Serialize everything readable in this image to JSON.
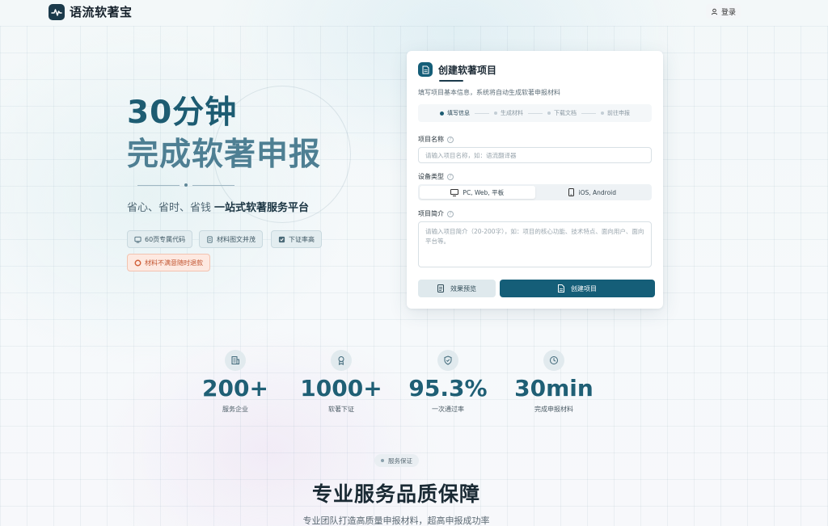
{
  "header": {
    "logo_text": "语流软著宝",
    "login_label": "登录"
  },
  "hero": {
    "title_line1": "30分钟",
    "title_line2": "完成软著申报",
    "subtitle_plain": "省心、省时、省钱",
    "subtitle_bold": "一站式软著服务平台",
    "features": [
      {
        "label": "60页专属代码",
        "icon": "code-icon"
      },
      {
        "label": "材料图文并茂",
        "icon": "document-icon"
      },
      {
        "label": "下证率高",
        "icon": "check-icon"
      }
    ],
    "guarantee": {
      "label": "材料不满意随时退款",
      "icon": "refund-icon"
    }
  },
  "form": {
    "title": "创建软著项目",
    "description": "填写项目基本信息，系统将自动生成软著申报材料",
    "steps": [
      "填写信息",
      "生成材料",
      "下载文档",
      "前往申报"
    ],
    "active_step": 0,
    "project_name": {
      "label": "项目名称",
      "placeholder": "请输入项目名称，如：语流翻译器",
      "value": ""
    },
    "device_type": {
      "label": "设备类型",
      "options": [
        "PC, Web, 平板",
        "iOS, Android"
      ],
      "selected": 0
    },
    "project_intro": {
      "label": "项目简介",
      "placeholder": "请输入项目简介（20-200字），如：项目的核心功能、技术特点、面向用户、面向平台等。",
      "value": ""
    },
    "preview_label": "效果预览",
    "create_label": "创建项目"
  },
  "stats": [
    {
      "value": "200+",
      "caption": "服务企业",
      "icon": "building-icon"
    },
    {
      "value": "1000+",
      "caption": "软著下证",
      "icon": "award-icon"
    },
    {
      "value": "95.3%",
      "caption": "一次通过率",
      "icon": "shield-check-icon"
    },
    {
      "value": "30min",
      "caption": "完成申报材料",
      "icon": "clock-icon"
    }
  ],
  "section": {
    "pill": "服务保证",
    "title": "专业服务品质保障",
    "subtitle": "专业团队打造高质量申报材料，超高申报成功率"
  },
  "colors": {
    "primary": "#155e78",
    "hero_title": "#1d5c72",
    "warn": "#c2542f"
  }
}
